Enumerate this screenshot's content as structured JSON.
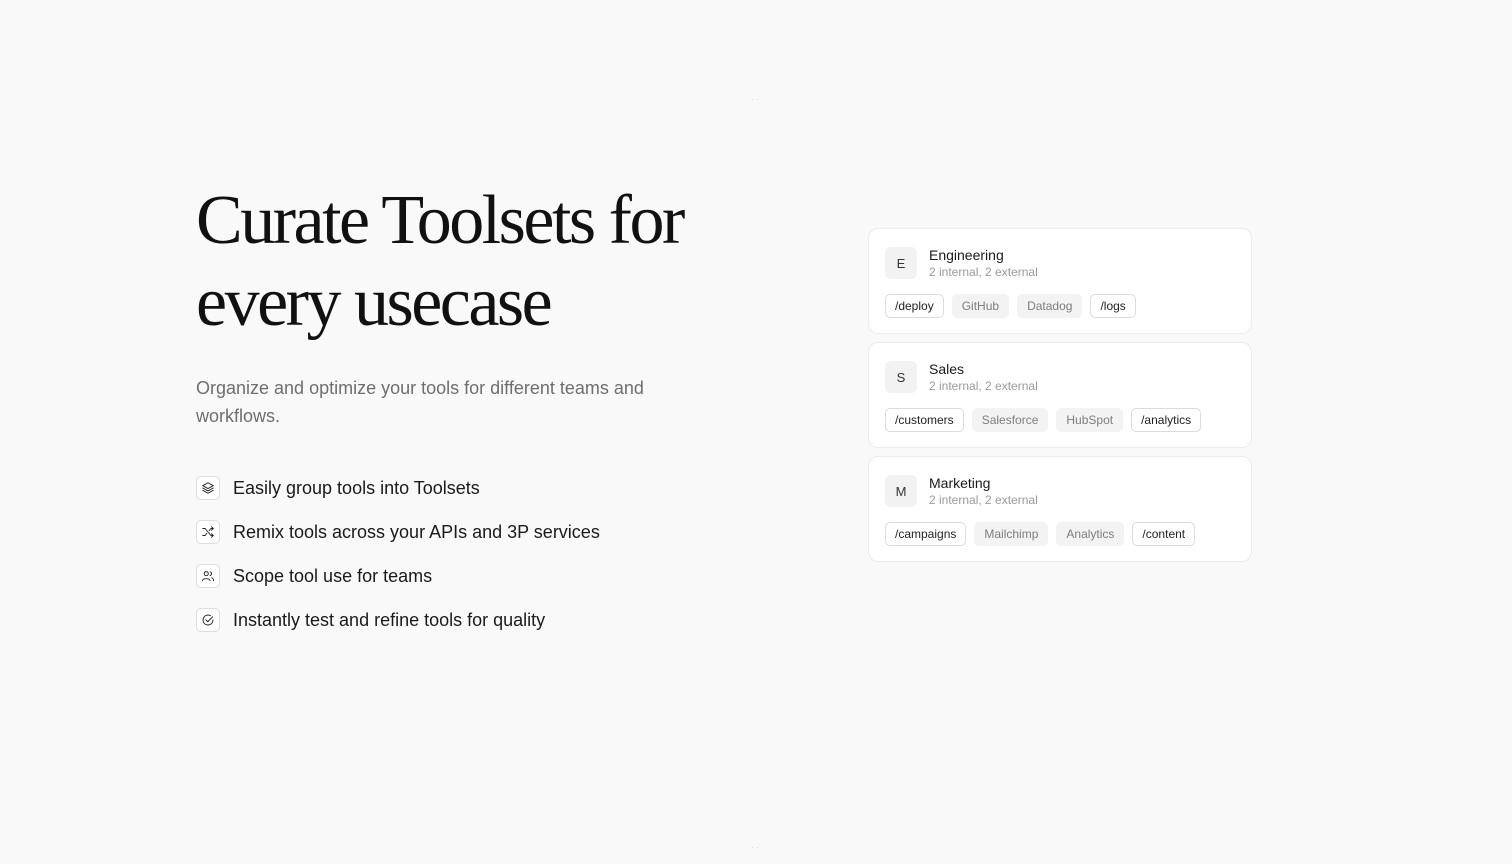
{
  "hero": {
    "headline_line1": "Curate Toolsets for",
    "headline_line2": "every usecase",
    "subtitle": "Organize and optimize your tools for different teams and workflows."
  },
  "features": [
    {
      "icon": "layers-icon",
      "label": "Easily group tools into Toolsets"
    },
    {
      "icon": "shuffle-icon",
      "label": "Remix tools across your APIs and 3P services"
    },
    {
      "icon": "users-icon",
      "label": "Scope tool use for teams"
    },
    {
      "icon": "check-circle-icon",
      "label": "Instantly test and refine tools for quality"
    }
  ],
  "toolsets": [
    {
      "initial": "E",
      "name": "Engineering",
      "meta": "2 internal, 2 external",
      "tags": [
        {
          "label": "/deploy",
          "kind": "internal"
        },
        {
          "label": "GitHub",
          "kind": "external"
        },
        {
          "label": "Datadog",
          "kind": "external"
        },
        {
          "label": "/logs",
          "kind": "internal"
        }
      ]
    },
    {
      "initial": "S",
      "name": "Sales",
      "meta": "2 internal, 2 external",
      "tags": [
        {
          "label": "/customers",
          "kind": "internal"
        },
        {
          "label": "Salesforce",
          "kind": "external"
        },
        {
          "label": "HubSpot",
          "kind": "external"
        },
        {
          "label": "/analytics",
          "kind": "internal"
        }
      ]
    },
    {
      "initial": "M",
      "name": "Marketing",
      "meta": "2 internal, 2 external",
      "tags": [
        {
          "label": "/campaigns",
          "kind": "internal"
        },
        {
          "label": "Mailchimp",
          "kind": "external"
        },
        {
          "label": "Analytics",
          "kind": "external"
        },
        {
          "label": "/content",
          "kind": "internal"
        }
      ]
    }
  ],
  "colors": {
    "background": "#f9f9f9",
    "card": "#ffffff",
    "text": "#1a1a1a",
    "muted": "#6e6e6e",
    "external_tag_bg": "#f3f3f3"
  }
}
